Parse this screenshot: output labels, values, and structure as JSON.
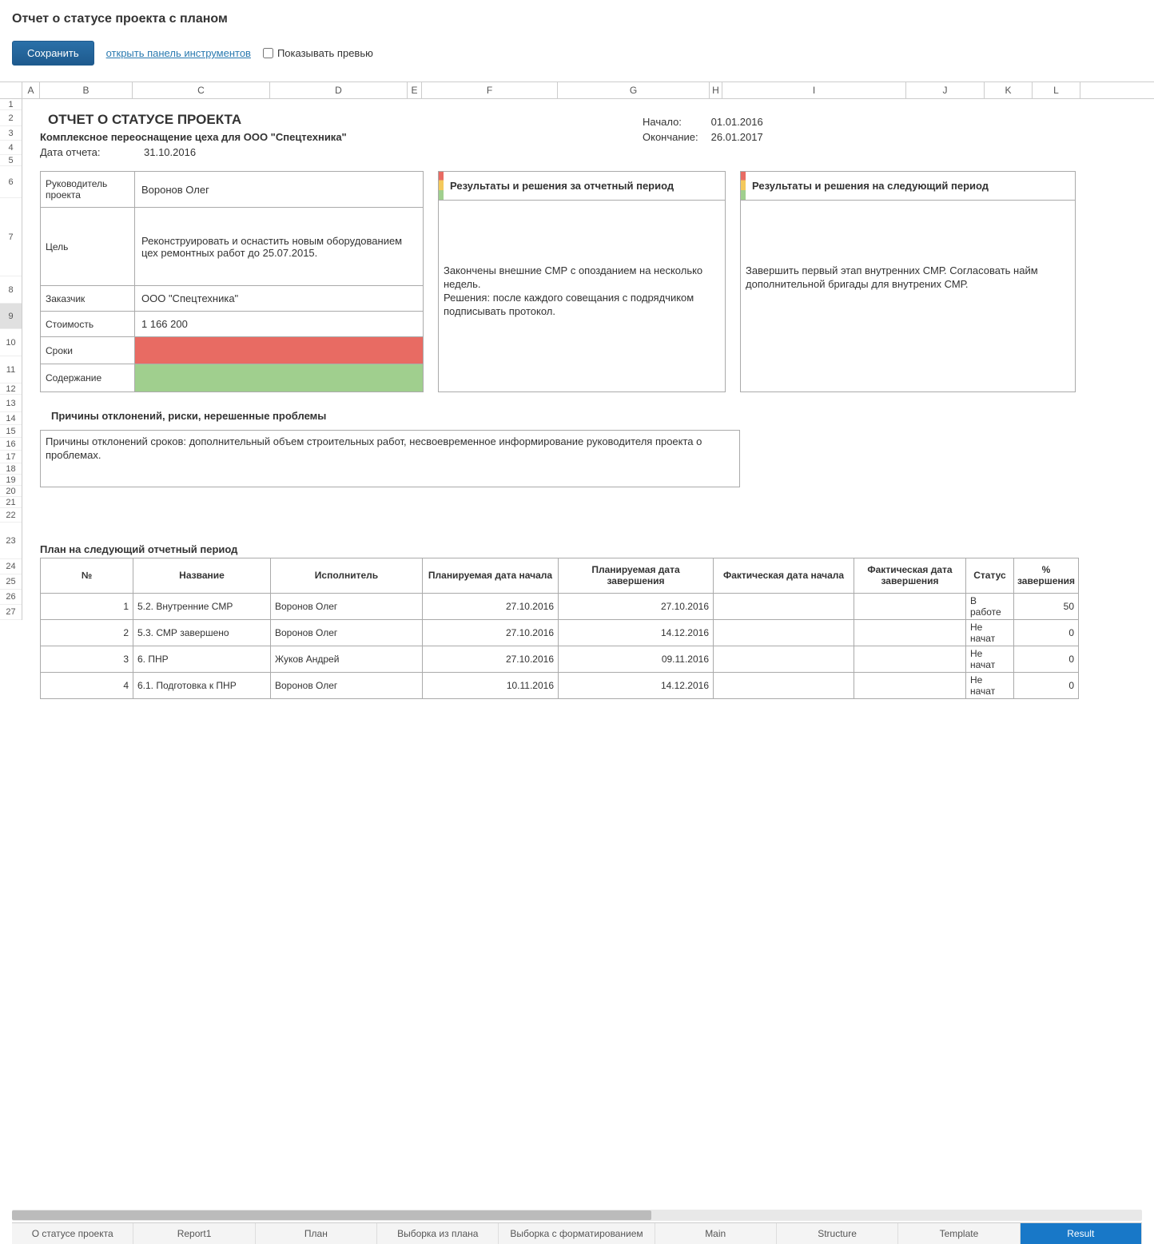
{
  "header": {
    "page_title": "Отчет о статусе проекта с планом",
    "save_label": "Сохранить",
    "open_panel_label": "открыть панель инструментов",
    "preview_label": "Показывать превью"
  },
  "columns": [
    "A",
    "B",
    "C",
    "D",
    "E",
    "F",
    "G",
    "H",
    "I",
    "J",
    "K",
    "L"
  ],
  "rownums": [
    "1",
    "2",
    "3",
    "4",
    "5",
    "6",
    "7",
    "8",
    "9",
    "10",
    "11",
    "12",
    "13",
    "14",
    "15",
    "16",
    "17",
    "18",
    "19",
    "20",
    "21",
    "22",
    "23",
    "24",
    "25",
    "26",
    "27"
  ],
  "report": {
    "title": "ОТЧЕТ О СТАТУСЕ ПРОЕКТА",
    "subtitle": "Комплексное переоснащение цеха для ООО \"Спецтехника\"",
    "report_date_label": "Дата отчета:",
    "report_date": "31.10.2016",
    "start_label": "Начало:",
    "start_date": "01.01.2016",
    "end_label": "Окончание:",
    "end_date": "26.01.2017"
  },
  "info": {
    "manager_label": "Руководитель проекта",
    "manager": "Воронов Олег",
    "goal_label": "Цель",
    "goal": "Реконструировать и оснастить новым оборудованием цех ремонтных работ до 25.07.2015.",
    "customer_label": "Заказчик",
    "customer": "ООО \"Спецтехника\"",
    "cost_label": "Стоимость",
    "cost": "1 166 200",
    "schedule_label": "Сроки",
    "scope_label": "Содержание"
  },
  "panel1": {
    "title": "Результаты и решения за отчетный период",
    "body": "Закончены внешние СМР с опозданием на несколько недель.\nРешения: после каждого совещания с подрядчиком подписывать протокол."
  },
  "panel2": {
    "title": "Результаты и решения на следующий период",
    "body": "Завершить первый этап внутренних СМР. Согласовать найм дополнительной бригады для внутрених СМР."
  },
  "issues": {
    "title": "Причины отклонений, риски, нерешенные проблемы",
    "body": "Причины отклонений сроков: дополнительный объем строительных работ, несвоевременное информирование руководителя проекта о проблемах."
  },
  "plan": {
    "title": "План на следующий отчетный период",
    "headers": {
      "num": "№",
      "name": "Название",
      "executor": "Исполнитель",
      "plan_start": "Планируемая дата начала",
      "plan_end": "Планируемая дата завершения",
      "fact_start": "Фактическая дата начала",
      "fact_end": "Фактическая дата завершения",
      "status": "Статус",
      "percent": "% завершения"
    },
    "rows": [
      {
        "n": "1",
        "name": "5.2. Внутренние СМР",
        "exec": "Воронов Олег",
        "ps": "27.10.2016",
        "pe": "27.10.2016",
        "fs": "",
        "fe": "",
        "st": "В работе",
        "pc": "50"
      },
      {
        "n": "2",
        "name": "5.3. СМР завершено",
        "exec": "Воронов Олег",
        "ps": "27.10.2016",
        "pe": "14.12.2016",
        "fs": "",
        "fe": "",
        "st": "Не начат",
        "pc": "0"
      },
      {
        "n": "3",
        "name": "6. ПНР",
        "exec": "Жуков Андрей",
        "ps": "27.10.2016",
        "pe": "09.11.2016",
        "fs": "",
        "fe": "",
        "st": "Не начат",
        "pc": "0"
      },
      {
        "n": "4",
        "name": "6.1. Подготовка к ПНР",
        "exec": "Воронов Олег",
        "ps": "10.11.2016",
        "pe": "14.12.2016",
        "fs": "",
        "fe": "",
        "st": "Не начат",
        "pc": "0"
      }
    ]
  },
  "tabs": {
    "items": [
      "О статусе проекта",
      "Report1",
      "План",
      "Выборка из плана",
      "Выборка с форматированием",
      "Main",
      "Structure",
      "Template",
      "Result"
    ],
    "active_index": 8
  },
  "colors": {
    "red": "#e86b63",
    "green": "#a0cf8e",
    "accent": "#1878c8"
  }
}
